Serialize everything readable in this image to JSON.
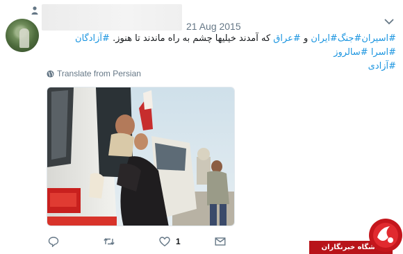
{
  "tweet": {
    "date": "21 Aug 2015",
    "text_line1": {
      "hashtags_start": [
        "#اسیران",
        "#جنگ",
        "#ایران"
      ],
      "conj": "و",
      "hashtag_iraq": "#عراق",
      "body": "که آمدند خیلیها چشم به راه ماندند تا هنوز.",
      "hashtags_end": [
        "#آزادگان",
        "#اسرا",
        "#سالروز"
      ]
    },
    "text_line2": "#آزادی",
    "translate_label": "Translate from Persian",
    "like_count": "1"
  },
  "icons": {
    "follow": "person-icon",
    "caret": "chevron-down-icon",
    "globe": "globe-icon",
    "reply": "reply-icon",
    "retweet": "retweet-icon",
    "like": "heart-icon",
    "dm": "envelope-icon"
  },
  "watermark": {
    "label": "باشگاه خبرنگاران"
  },
  "colors": {
    "link": "#1b95e0",
    "muted": "#657786",
    "watermark_red": "#b8141a"
  }
}
